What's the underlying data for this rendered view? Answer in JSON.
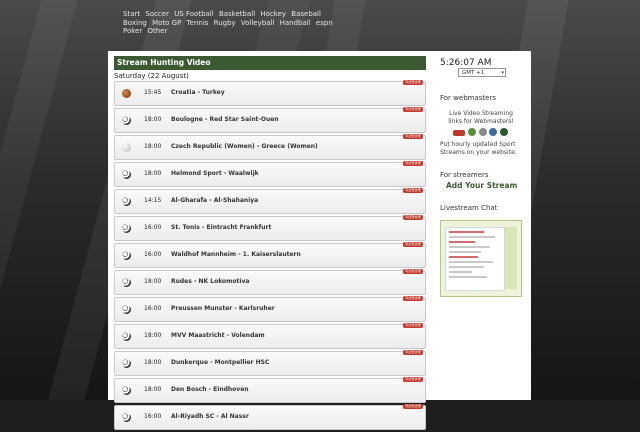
{
  "nav": [
    "Start",
    "Soccer",
    "US Football",
    "Basketball",
    "Hockey",
    "Baseball",
    "Boxing",
    "Moto GP",
    "Tennis",
    "Rugby",
    "Volleyball",
    "Handball",
    "espn",
    "Poker",
    "Other"
  ],
  "main": {
    "section_title": "Stream Hunting Video",
    "date_label": "Saturday (22 August)",
    "badge_label": "지금방송중",
    "events": [
      {
        "sport_icon": "basketball-icon",
        "time": "15:45",
        "match": "Croatia - Turkey"
      },
      {
        "sport_icon": "soccer-ball-icon",
        "time": "18:00",
        "match": "Boulogne - Red Star Saint-Ouen"
      },
      {
        "sport_icon": "volleyball-icon",
        "time": "18:00",
        "match": "Czech Republic (Women) - Greece (Women)"
      },
      {
        "sport_icon": "soccer-ball-icon",
        "time": "18:00",
        "match": "Helmond Sport - Waalwijk"
      },
      {
        "sport_icon": "soccer-ball-icon",
        "time": "14:15",
        "match": "Al-Gharafa - Al-Shahaniya"
      },
      {
        "sport_icon": "soccer-ball-icon",
        "time": "16:00",
        "match": "St. Tonis - Eintracht Frankfurt"
      },
      {
        "sport_icon": "soccer-ball-icon",
        "time": "16:00",
        "match": "Waldhof Mannheim - 1. Kaiserslautern"
      },
      {
        "sport_icon": "soccer-ball-icon",
        "time": "18:00",
        "match": "Rudes - NK Lokomotiva"
      },
      {
        "sport_icon": "soccer-ball-icon",
        "time": "16:00",
        "match": "Preussen Munster - Karlsruher"
      },
      {
        "sport_icon": "soccer-ball-icon",
        "time": "18:00",
        "match": "MVV Maastricht - Volendam"
      },
      {
        "sport_icon": "soccer-ball-icon",
        "time": "18:00",
        "match": "Dunkerque - Montpellier HSC"
      },
      {
        "sport_icon": "soccer-ball-icon",
        "time": "18:00",
        "match": "Den Bosch - Eindhoven"
      },
      {
        "sport_icon": "soccer-ball-icon",
        "time": "16:00",
        "match": "Al-Riyadh SC - Al Nassr"
      }
    ]
  },
  "sidebar": {
    "clock": "5:26:07 AM",
    "timezone": "GMT +1",
    "webmasters_title": "For webmasters",
    "webmasters_box_text": "Live Video Streaming links for Webmasters!",
    "webmasters_desc": "Put hourly updated Sport Streams on your website.",
    "streamers_title": "For streamers",
    "add_stream_label": "Add Your Stream",
    "chat_title": "Livestream Chat"
  },
  "colors": {
    "header_green": "#3c5a32",
    "badge_red": "#c0392b"
  }
}
